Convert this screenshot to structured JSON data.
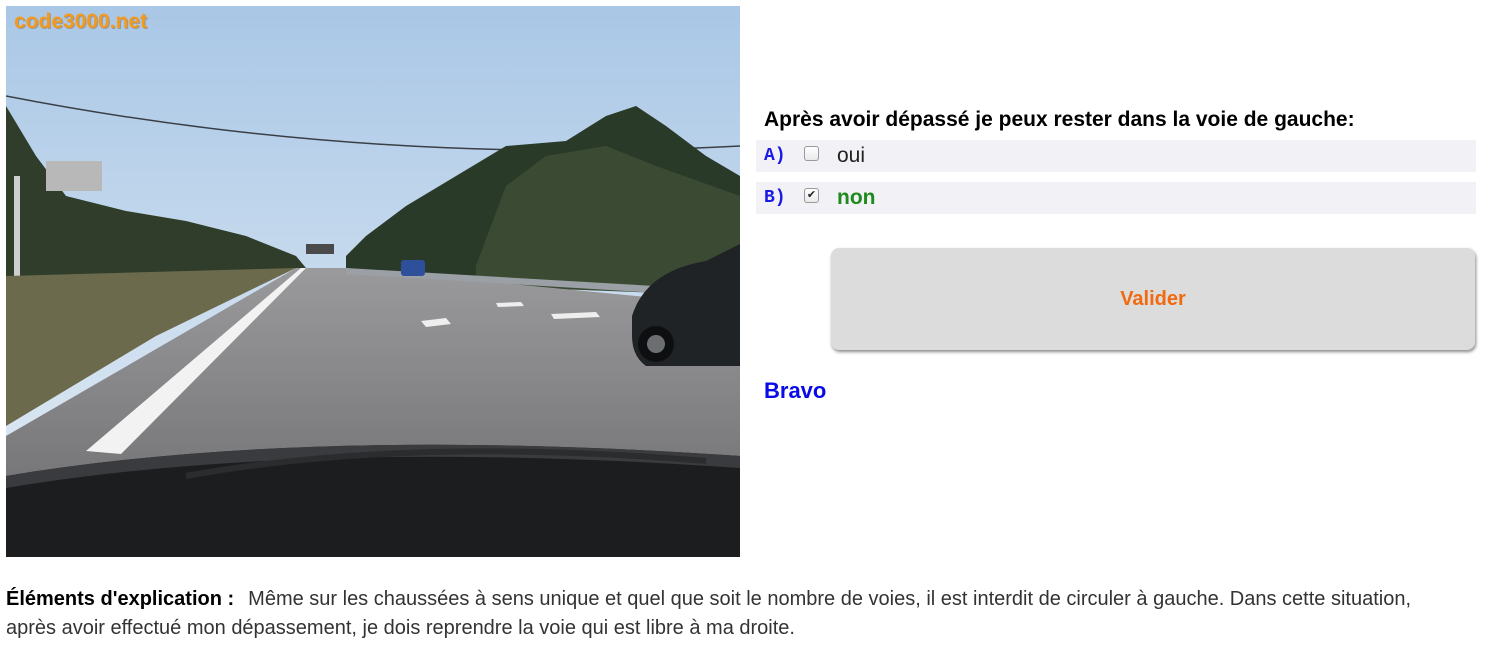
{
  "photo": {
    "watermark": "code3000.net",
    "description_icon": "road-scene-image"
  },
  "question": {
    "text": "Après avoir dépassé je peux rester dans la voie de gauche:"
  },
  "answers": [
    {
      "letter": "A)",
      "text": "oui",
      "checked": false
    },
    {
      "letter": "B)",
      "text": "non",
      "checked": true
    }
  ],
  "actions": {
    "validate_label": "Valider"
  },
  "feedback": {
    "text": "Bravo"
  },
  "explanation": {
    "heading": "Éléments d'explication :",
    "body": "Même sur les chaussées à sens unique et quel que soit le nombre de voies, il est interdit de circuler à gauche. Dans cette situation, après avoir effectué mon dépassement, je dois reprendre la voie qui est libre à ma droite."
  },
  "colors": {
    "question_letter": "#1a1ae6",
    "correct_answer": "#1e8a1e",
    "validate_text": "#f26a0f",
    "feedback": "#0a0ae8",
    "watermark": "#f39a1e"
  }
}
